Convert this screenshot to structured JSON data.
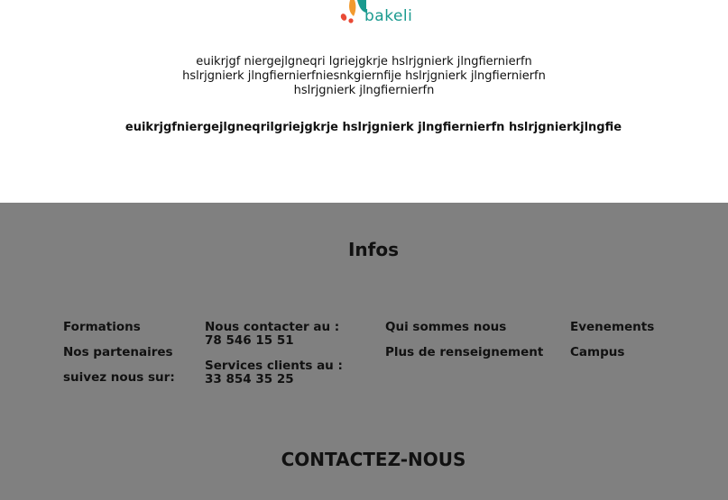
{
  "logo": {
    "text": "bakeli",
    "colors": {
      "orange": "#f29a2e",
      "red": "#e94a35",
      "teal": "#1a9a8f"
    }
  },
  "intro": {
    "line1": "euikrjgf niergejlgneqri lgriejgkrje hslrjgnierk jlngfiernierfn",
    "line2": "hslrjgnierk jlngfiernierfniesnkgiernfije hslrjgnierk jlngfiernierfn",
    "line3": "hslrjgnierk jlngfiernierfn",
    "bold": "euikrjgfniergejlgneqrilgriejgkrje hslrjgnierk jlngfiernierfn hslrjgnierkjlngfie"
  },
  "footer": {
    "background": "#808080",
    "title": "Infos",
    "col1": [
      "Formations",
      "Nos partenaires",
      "suivez nous sur:"
    ],
    "col2": {
      "contact_label": "Nous contacter au :",
      "contact_number": "78 546 15 51",
      "service_label": "Services clients au :",
      "service_number": "33 854 35 25"
    },
    "col3": [
      "Qui sommes nous",
      "Plus de renseignement"
    ],
    "col4": [
      "Evenements",
      "Campus"
    ],
    "contact_title": "CONTACTEZ-NOUS"
  }
}
